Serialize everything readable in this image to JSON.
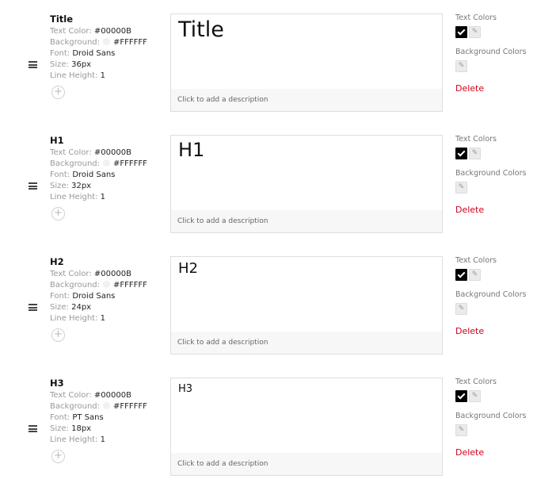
{
  "labels": {
    "text_color": "Text Color:",
    "background": "Background:",
    "font": "Font:",
    "size": "Size:",
    "line_height": "Line Height:",
    "text_colors": "Text Colors",
    "background_colors": "Background Colors",
    "delete": "Delete",
    "add_description": "Click to add a description",
    "add_icon": "+",
    "edit_icon": "✎"
  },
  "styles": [
    {
      "name": "Title",
      "text_color": "#00000B",
      "background": "#FFFFFF",
      "font": "Droid Sans",
      "size": "36px",
      "line_height": "1",
      "sample": "Title"
    },
    {
      "name": "H1",
      "text_color": "#00000B",
      "background": "#FFFFFF",
      "font": "Droid Sans",
      "size": "32px",
      "line_height": "1",
      "sample": "H1"
    },
    {
      "name": "H2",
      "text_color": "#00000B",
      "background": "#FFFFFF",
      "font": "Droid Sans",
      "size": "24px",
      "line_height": "1",
      "sample": "H2"
    },
    {
      "name": "H3",
      "text_color": "#00000B",
      "background": "#FFFFFF",
      "font": "PT Sans",
      "size": "18px",
      "line_height": "1",
      "sample": "H3"
    }
  ],
  "colors": {
    "text_chip": "#000000",
    "delete": "#d0021b"
  }
}
